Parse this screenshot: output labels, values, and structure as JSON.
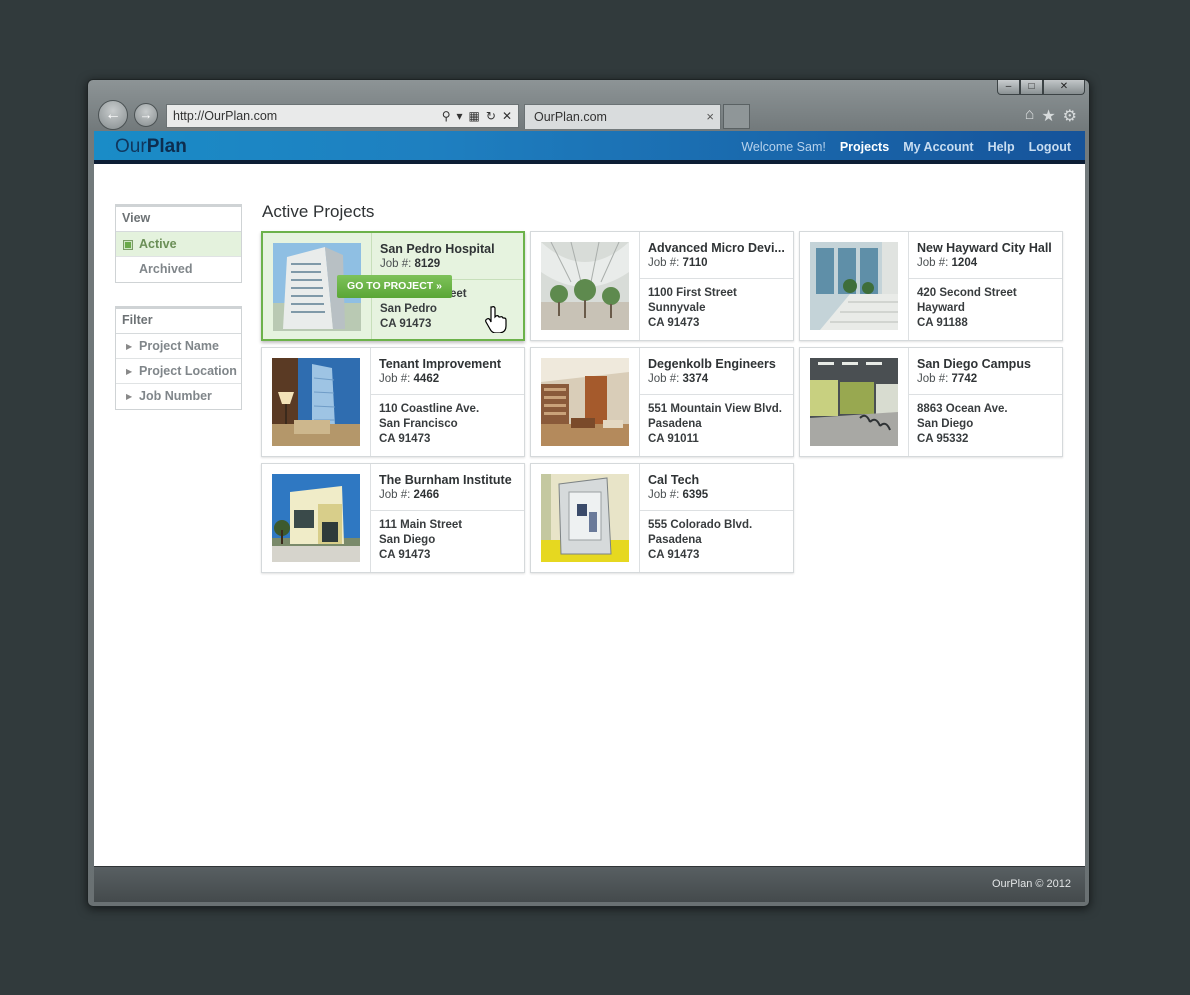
{
  "browser": {
    "url": "http://OurPlan.com",
    "tab_title": "OurPlan.com",
    "tab_close": "×",
    "win_minimize": "–",
    "win_maximize": "□",
    "win_close": "✕"
  },
  "site": {
    "logo_our": "Our",
    "logo_plan": "Plan",
    "welcome": "Welcome Sam!",
    "nav": [
      "Projects",
      "My Account",
      "Help",
      "Logout"
    ],
    "footer": "OurPlan © 2012"
  },
  "sidebar": {
    "view_header": "View",
    "view_items": [
      "Active",
      "Archived"
    ],
    "filter_header": "Filter",
    "filter_items": [
      "Project Name",
      "Project Location",
      "Job Number"
    ]
  },
  "main": {
    "title": "Active Projects",
    "go_to_label": "GO TO PROJECT »",
    "job_label": "Job #:",
    "projects": [
      {
        "name": "San Pedro Hospital",
        "job": "8129",
        "street": "eet",
        "city": "San Pedro",
        "state": "CA 91473"
      },
      {
        "name": "Advanced Micro Devi...",
        "job": "7110",
        "street": "1100 First Street",
        "city": "Sunnyvale",
        "state": "CA 91473"
      },
      {
        "name": "New Hayward City Hall",
        "job": "1204",
        "street": "420 Second Street",
        "city": "Hayward",
        "state": "CA 91188"
      },
      {
        "name": "Tenant Improvement",
        "job": "4462",
        "street": "110 Coastline Ave.",
        "city": "San Francisco",
        "state": "CA 91473"
      },
      {
        "name": "Degenkolb Engineers",
        "job": "3374",
        "street": "551 Mountain View Blvd.",
        "city": "Pasadena",
        "state": "CA 91011"
      },
      {
        "name": "San Diego Campus",
        "job": "7742",
        "street": "8863 Ocean Ave.",
        "city": "San Diego",
        "state": "CA 95332"
      },
      {
        "name": "The Burnham Institute",
        "job": "2466",
        "street": "111 Main Street",
        "city": "San Diego",
        "state": "CA 91473"
      },
      {
        "name": "Cal Tech",
        "job": "6395",
        "street": "555 Colorado Blvd.",
        "city": "Pasadena",
        "state": "CA 91473"
      }
    ]
  },
  "colors": {
    "accent_green": "#6cb24a",
    "header_blue": "#1a8cc7",
    "selected_bg": "#e4f2dd"
  }
}
